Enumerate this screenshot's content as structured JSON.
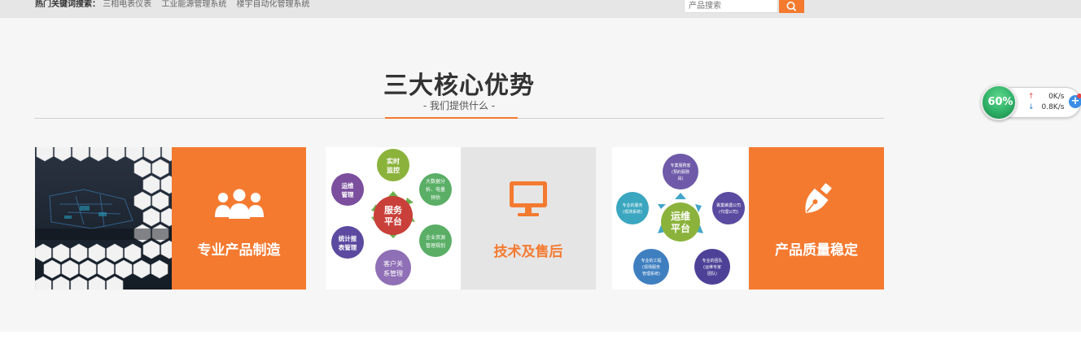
{
  "topbar": {
    "hot_label": "热门关键词搜索：",
    "keywords": [
      "三相电表仪表",
      "工业能源管理系统",
      "楼宇自动化管理系统"
    ],
    "search_placeholder": "产品搜索",
    "search_icon": "magnifier-icon"
  },
  "section": {
    "title": "三大核心优势",
    "subtitle": "- 我们提供什么 -"
  },
  "cards": [
    {
      "label": "专业产品制造",
      "icon": "people-group-icon",
      "image": "hexagon-control-room-photo"
    },
    {
      "label": "技术及售后",
      "icon": "monitor-icon",
      "image": "service-platform-diagram",
      "diagram": {
        "center": [
          "服务",
          "平台"
        ],
        "nodes": [
          [
            "实时",
            "监控"
          ],
          [
            "大数据分",
            "析、电量",
            "预估"
          ],
          [
            "企业资源",
            "管理规划"
          ],
          [
            "客户关",
            "系管理"
          ],
          [
            "统计报",
            "表管理"
          ],
          [
            "运维",
            "管理"
          ]
        ]
      }
    },
    {
      "label": "产品质量稳定",
      "icon": "fountain-pen-icon",
      "image": "operations-platform-diagram",
      "diagram": {
        "center": [
          "运维",
          "平台"
        ],
        "nodes": [
          [
            "专業服務客",
            "(預約服務",
            "員)"
          ],
          [
            "專業維護公司",
            "(代理公司)"
          ],
          [
            "专业的团队",
            "(运维专家",
            "团队)"
          ],
          [
            "专业的工程",
            "(现场服务",
            "管理系统)"
          ],
          [
            "专业的服务",
            "(观测系统)"
          ]
        ]
      }
    }
  ],
  "widget": {
    "percent": "60%",
    "upload": "0K/s",
    "download": "0.8K/s",
    "colors": {
      "ring": "#2fb067",
      "up": "#e54545",
      "down": "#2b7fd6"
    }
  },
  "colors": {
    "accent": "#f47a30",
    "panel_gray": "#e5e5e5"
  }
}
